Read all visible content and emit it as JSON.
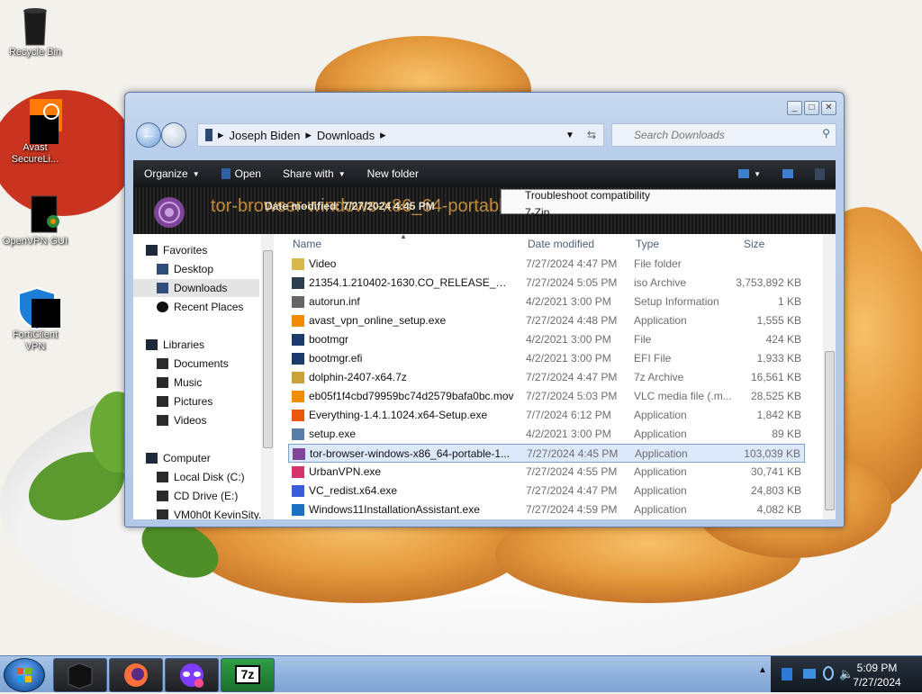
{
  "desktop": {
    "icons": [
      {
        "label": "Recycle Bin"
      },
      {
        "label": "Avast SecureLi..."
      },
      {
        "label": "OpenVPN GUI"
      },
      {
        "label": "FortiClient VPN"
      }
    ]
  },
  "window": {
    "breadcrumbs": [
      "Joseph Biden",
      "Downloads"
    ],
    "search_placeholder": "Search Downloads",
    "toolbar": {
      "organize": "Organize",
      "open": "Open",
      "share_with": "Share with",
      "new_folder": "New folder"
    },
    "drag_preview": {
      "title": "tor-browser-windows-x86_64-portable-1...",
      "overlay_text": "Date modified: 7/27/2024 4:45 PM"
    },
    "context_menu": {
      "item1": "Troubleshoot compatibility",
      "item2": "7-Zip"
    },
    "nav": {
      "favorites": "Favorites",
      "desktop": "Desktop",
      "downloads": "Downloads",
      "recent": "Recent Places",
      "libraries": "Libraries",
      "documents": "Documents",
      "music": "Music",
      "pictures": "Pictures",
      "videos": "Videos",
      "computer": "Computer",
      "local_disk": "Local Disk (C:)",
      "cd_drive": "CD Drive (E:)",
      "network": "VM0h0t KevinSity..."
    },
    "columns": {
      "name": "Name",
      "date": "Date modified",
      "type": "Type",
      "size": "Size"
    },
    "files": [
      {
        "name": "Video",
        "date": "7/27/2024 4:47 PM",
        "type": "File folder",
        "size": ""
      },
      {
        "name": "21354.1.210402-1630.CO_RELEASE_CLIEN...",
        "date": "7/27/2024 5:05 PM",
        "type": "iso Archive",
        "size": "3,753,892 KB"
      },
      {
        "name": "autorun.inf",
        "date": "4/2/2021 3:00 PM",
        "type": "Setup Information",
        "size": "1 KB"
      },
      {
        "name": "avast_vpn_online_setup.exe",
        "date": "7/27/2024 4:48 PM",
        "type": "Application",
        "size": "1,555 KB"
      },
      {
        "name": "bootmgr",
        "date": "4/2/2021 3:00 PM",
        "type": "File",
        "size": "424 KB"
      },
      {
        "name": "bootmgr.efi",
        "date": "4/2/2021 3:00 PM",
        "type": "EFI File",
        "size": "1,933 KB"
      },
      {
        "name": "dolphin-2407-x64.7z",
        "date": "7/27/2024 4:47 PM",
        "type": "7z Archive",
        "size": "16,561 KB"
      },
      {
        "name": "eb05f1f4cbd79959bc74d2579bafa0bc.mov",
        "date": "7/27/2024 5:03 PM",
        "type": "VLC media file (.m...",
        "size": "28,525 KB"
      },
      {
        "name": "Everything-1.4.1.1024.x64-Setup.exe",
        "date": "7/7/2024 6:12 PM",
        "type": "Application",
        "size": "1,842 KB"
      },
      {
        "name": "setup.exe",
        "date": "4/2/2021 3:00 PM",
        "type": "Application",
        "size": "89 KB"
      },
      {
        "name": "tor-browser-windows-x86_64-portable-1...",
        "date": "7/27/2024 4:45 PM",
        "type": "Application",
        "size": "103,039 KB"
      },
      {
        "name": "UrbanVPN.exe",
        "date": "7/27/2024 4:55 PM",
        "type": "Application",
        "size": "30,741 KB"
      },
      {
        "name": "VC_redist.x64.exe",
        "date": "7/27/2024 4:47 PM",
        "type": "Application",
        "size": "24,803 KB"
      },
      {
        "name": "Windows11InstallationAssistant.exe",
        "date": "7/27/2024 4:59 PM",
        "type": "Application",
        "size": "4,082 KB"
      }
    ]
  },
  "taskbar": {
    "time": "5:09 PM",
    "date": "7/27/2024",
    "sevenzip_label": "7z"
  }
}
